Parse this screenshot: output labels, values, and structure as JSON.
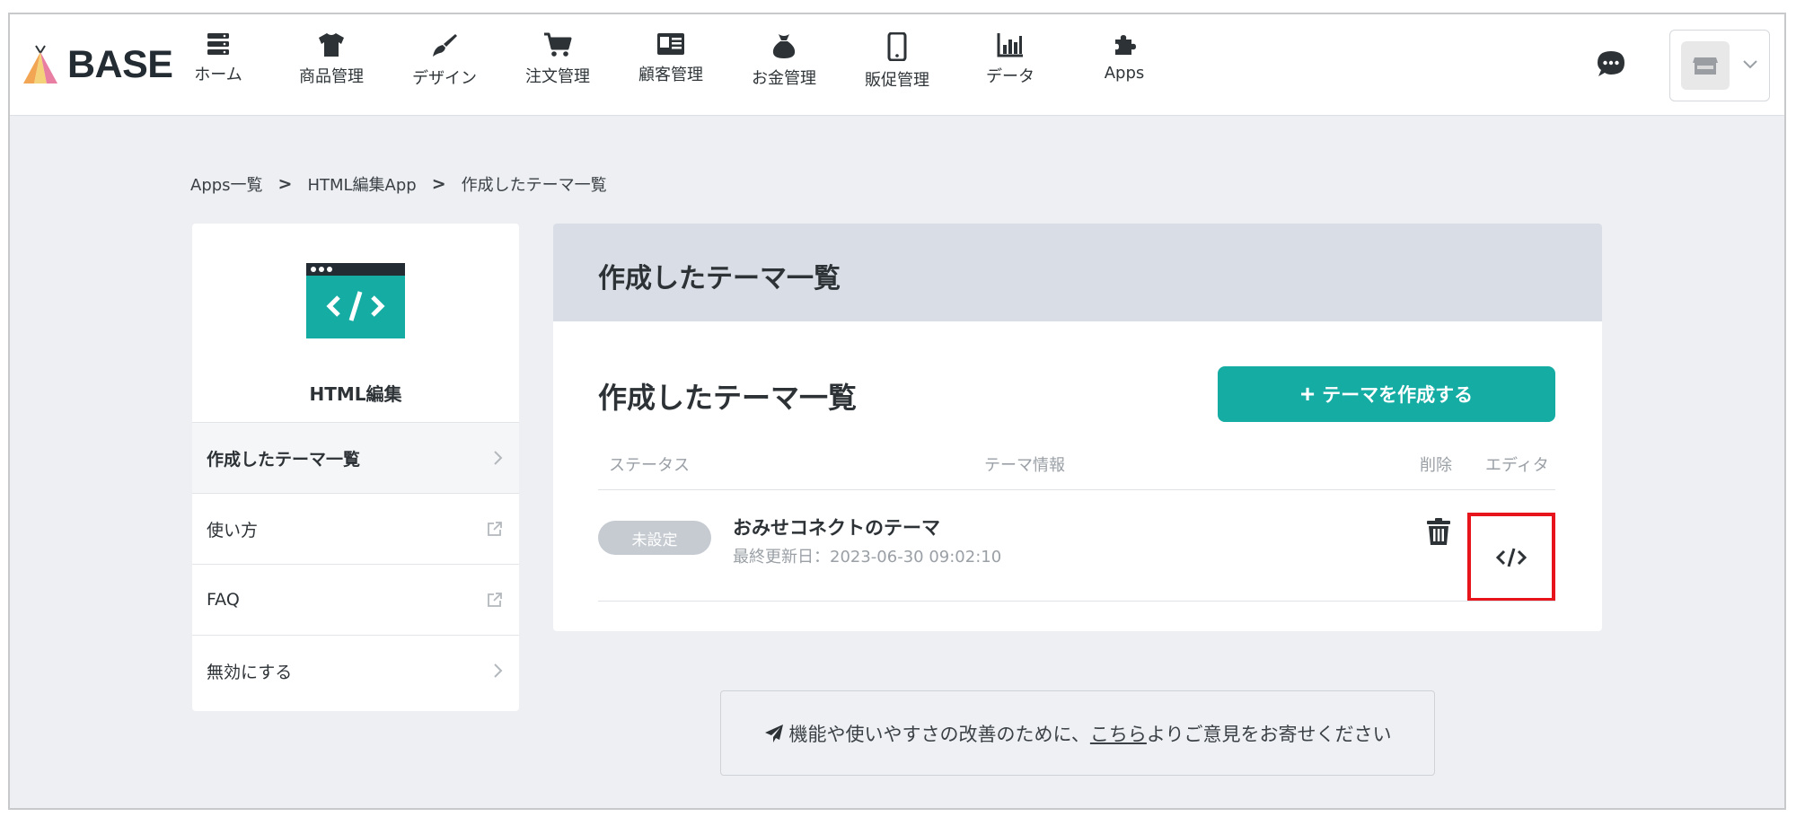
{
  "header": {
    "logo_text": "BASE",
    "nav": [
      {
        "label": "ホーム",
        "icon": "server-icon"
      },
      {
        "label": "商品管理",
        "icon": "tshirt-icon"
      },
      {
        "label": "デザイン",
        "icon": "paintbrush-icon"
      },
      {
        "label": "注文管理",
        "icon": "cart-icon"
      },
      {
        "label": "顧客管理",
        "icon": "address-card-icon"
      },
      {
        "label": "お金管理",
        "icon": "money-bag-icon"
      },
      {
        "label": "販促管理",
        "icon": "mobile-icon"
      },
      {
        "label": "データ",
        "icon": "bar-chart-icon"
      },
      {
        "label": "Apps",
        "icon": "puzzle-icon"
      }
    ]
  },
  "breadcrumb": {
    "items": [
      "Apps一覧",
      "HTML編集App",
      "作成したテーマ一覧"
    ],
    "separator": ">"
  },
  "sidebar": {
    "app_name": "HTML編集",
    "items": [
      {
        "label": "作成したテーマ一覧",
        "trail": "chevron-right-icon",
        "active": true
      },
      {
        "label": "使い方",
        "trail": "external-link-icon"
      },
      {
        "label": "FAQ",
        "trail": "external-link-icon"
      },
      {
        "label": "無効にする",
        "trail": "chevron-right-icon"
      }
    ]
  },
  "main": {
    "header_title": "作成したテーマ一覧",
    "section_title": "作成したテーマ一覧",
    "create_button": {
      "plus": "+",
      "label": "テーマを作成する"
    },
    "columns": {
      "status": "ステータス",
      "info": "テーマ情報",
      "delete": "削除",
      "editor": "エディタ"
    },
    "rows": [
      {
        "status": "未設定",
        "name": "おみせコネクトのテーマ",
        "updated": "最終更新日：2023-06-30 09:02:10"
      }
    ]
  },
  "feedback": {
    "before": "機能や使いやすさの改善のために、",
    "link": "こちら",
    "after": "よりご意見をお寄せください"
  },
  "colors": {
    "accent": "#14aca3",
    "highlight_box": "#e8141b",
    "badge_bg": "#c6cbd2",
    "panel_header_bg": "#d9dde5",
    "page_bg": "#edeff2"
  }
}
